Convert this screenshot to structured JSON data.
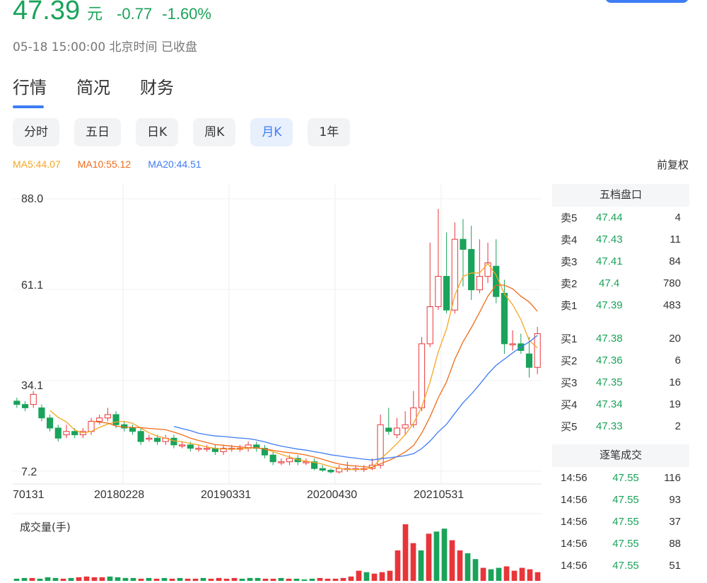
{
  "header": {
    "price": "47.39",
    "unit": "元",
    "change": "-0.77",
    "change_pct": "-1.60%",
    "status": "05-18 15:00:00 北京时间 已收盘"
  },
  "tabs": [
    {
      "label": "行情",
      "active": true
    },
    {
      "label": "简况",
      "active": false
    },
    {
      "label": "财务",
      "active": false
    }
  ],
  "periods": [
    {
      "label": "分时",
      "active": false
    },
    {
      "label": "五日",
      "active": false
    },
    {
      "label": "日K",
      "active": false
    },
    {
      "label": "周K",
      "active": false
    },
    {
      "label": "月K",
      "active": true
    },
    {
      "label": "1年",
      "active": false
    }
  ],
  "ma": {
    "ma5": "MA5:44.07",
    "ma10": "MA10:55.12",
    "ma20": "MA20:44.51"
  },
  "adjust_label": "前复权",
  "chart_data": {
    "type": "candlestick",
    "y_ticks": [
      "88.0",
      "61.1",
      "34.1",
      "7.2"
    ],
    "ylim": [
      7.2,
      88.0
    ],
    "x_labels": [
      "70131",
      "20180228",
      "20190331",
      "20200430",
      "20210531"
    ],
    "volume_label": "成交量(手)",
    "colors": {
      "up": "#e8353a",
      "down": "#1aa35a",
      "ma5": "#f5a623",
      "ma10": "#ef6c1a",
      "ma20": "#3e7cf4"
    },
    "candles": [
      [
        28,
        27,
        29,
        26
      ],
      [
        27,
        26,
        28,
        25
      ],
      [
        27,
        30,
        31,
        26
      ],
      [
        26,
        23,
        27,
        22
      ],
      [
        23,
        20,
        24,
        19
      ],
      [
        20,
        17,
        21,
        16
      ],
      [
        18,
        19,
        21,
        17
      ],
      [
        19,
        18,
        20,
        17
      ],
      [
        18,
        19,
        20,
        17
      ],
      [
        19,
        22,
        23,
        18
      ],
      [
        22,
        23,
        24,
        21
      ],
      [
        23,
        24,
        26,
        22
      ],
      [
        24,
        21,
        25,
        20
      ],
      [
        21,
        20,
        22,
        19
      ],
      [
        20,
        19,
        21,
        18
      ],
      [
        19,
        16,
        20,
        15
      ],
      [
        17,
        17,
        18,
        16
      ],
      [
        17,
        16,
        18,
        15
      ],
      [
        16,
        17,
        18,
        15
      ],
      [
        17,
        15,
        18,
        14
      ],
      [
        15,
        15,
        16,
        14
      ],
      [
        15,
        14,
        16,
        13
      ],
      [
        14,
        14,
        15,
        13
      ],
      [
        14,
        14,
        15,
        13
      ],
      [
        14,
        13,
        15,
        12
      ],
      [
        13,
        14,
        15,
        12
      ],
      [
        14,
        14,
        15,
        13
      ],
      [
        14,
        14,
        15,
        13
      ],
      [
        14,
        15,
        16,
        13
      ],
      [
        15,
        14,
        16,
        13
      ],
      [
        14,
        12,
        15,
        11
      ],
      [
        12,
        10,
        13,
        9
      ],
      [
        10,
        10,
        11,
        9
      ],
      [
        10,
        11,
        12,
        9
      ],
      [
        11,
        10,
        12,
        9
      ],
      [
        10,
        10,
        11,
        9
      ],
      [
        10,
        8,
        11,
        7.5
      ],
      [
        8,
        7.5,
        9,
        7
      ],
      [
        7.5,
        7,
        8,
        6.5
      ],
      [
        7,
        8,
        9,
        6.5
      ],
      [
        8,
        8,
        10,
        7
      ],
      [
        8,
        8,
        9,
        7
      ],
      [
        8,
        8,
        9,
        7
      ],
      [
        8,
        9,
        11,
        7.5
      ],
      [
        9,
        21,
        24,
        8
      ],
      [
        20,
        19,
        26,
        18
      ],
      [
        18,
        20,
        23,
        17
      ],
      [
        20,
        21,
        25,
        18
      ],
      [
        21,
        26,
        31,
        20
      ],
      [
        26,
        45,
        47,
        25
      ],
      [
        45,
        56,
        75,
        44
      ],
      [
        56,
        65,
        85,
        55
      ],
      [
        65,
        55,
        78,
        54
      ],
      [
        55,
        76,
        81,
        54
      ],
      [
        76,
        73,
        82,
        62
      ],
      [
        73,
        61,
        80,
        58
      ],
      [
        61,
        65,
        76,
        60
      ],
      [
        65,
        69,
        75,
        63
      ],
      [
        68,
        59,
        76,
        57
      ],
      [
        60,
        45,
        64,
        42
      ],
      [
        45,
        45,
        49,
        43
      ],
      [
        45,
        43,
        48,
        42
      ],
      [
        42,
        38,
        47,
        35
      ],
      [
        38,
        48,
        50,
        36
      ]
    ],
    "volumes": [
      3,
      4,
      4,
      3,
      5,
      4,
      3,
      4,
      5,
      6,
      5,
      5,
      6,
      5,
      4,
      4,
      3,
      4,
      3,
      4,
      3,
      4,
      3,
      3,
      4,
      3,
      4,
      3,
      4,
      3,
      4,
      4,
      3,
      3,
      4,
      3,
      3,
      2,
      3,
      4,
      3,
      3,
      4,
      6,
      14,
      12,
      10,
      12,
      14,
      42,
      78,
      52,
      42,
      65,
      68,
      72,
      56,
      42,
      38,
      30,
      18,
      16,
      18,
      20,
      14,
      18,
      16,
      12
    ]
  },
  "order_book": {
    "title": "五档盘口",
    "asks": [
      {
        "label": "卖5",
        "price": "47.44",
        "volume": "4"
      },
      {
        "label": "卖4",
        "price": "47.43",
        "volume": "11"
      },
      {
        "label": "卖3",
        "price": "47.41",
        "volume": "84"
      },
      {
        "label": "卖2",
        "price": "47.4",
        "volume": "780"
      },
      {
        "label": "卖1",
        "price": "47.39",
        "volume": "483"
      }
    ],
    "bids": [
      {
        "label": "买1",
        "price": "47.38",
        "volume": "20"
      },
      {
        "label": "买2",
        "price": "47.36",
        "volume": "6"
      },
      {
        "label": "买3",
        "price": "47.35",
        "volume": "16"
      },
      {
        "label": "买4",
        "price": "47.34",
        "volume": "19"
      },
      {
        "label": "买5",
        "price": "47.33",
        "volume": "2"
      }
    ]
  },
  "trades": {
    "title": "逐笔成交",
    "rows": [
      {
        "time": "14:56",
        "price": "47.55",
        "volume": "116"
      },
      {
        "time": "14:56",
        "price": "47.55",
        "volume": "93"
      },
      {
        "time": "14:56",
        "price": "47.55",
        "volume": "37"
      },
      {
        "time": "14:56",
        "price": "47.55",
        "volume": "88"
      },
      {
        "time": "14:56",
        "price": "47.55",
        "volume": "51"
      }
    ]
  }
}
